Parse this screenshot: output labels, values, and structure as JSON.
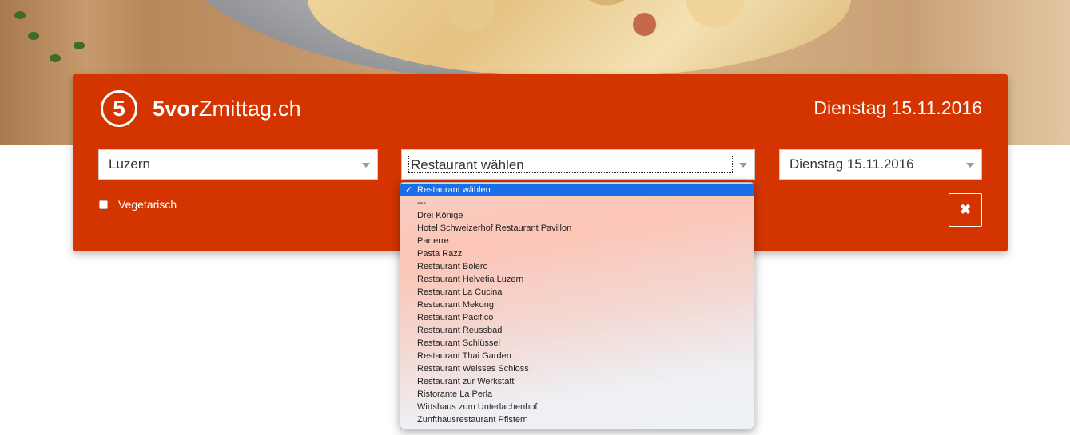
{
  "brand": {
    "logo_mark": "5",
    "name_bold": "5vor",
    "name_rest": "Zmittag.ch"
  },
  "header": {
    "date": "Dienstag 15.11.2016"
  },
  "filters": {
    "city": "Luzern",
    "restaurant": "Restaurant wählen",
    "date": "Dienstag 15.11.2016",
    "vegetarian_label": "Vegetarisch",
    "clear_icon": "✖"
  },
  "dropdown": {
    "check_icon": "✓",
    "options": [
      "Restaurant wählen",
      "---",
      "Drei Könige",
      "Hotel Schweizerhof Restaurant Pavillon",
      "Parterre",
      "Pasta Razzi",
      "Restaurant Bolero",
      "Restaurant Helvetia Luzern",
      "Restaurant La Cucina",
      "Restaurant Mekong",
      "Restaurant Pacifico",
      "Restaurant Reussbad",
      "Restaurant Schlüssel",
      "Restaurant Thai Garden",
      "Restaurant Weisses Schloss",
      "Restaurant zur Werkstatt",
      "Ristorante La Perla",
      "Wirtshaus zum Unterlachenhof",
      "Zunfthausrestaurant Pfistern"
    ]
  },
  "colors": {
    "brand_red": "#d43500",
    "highlight": "#1a6ee8"
  }
}
